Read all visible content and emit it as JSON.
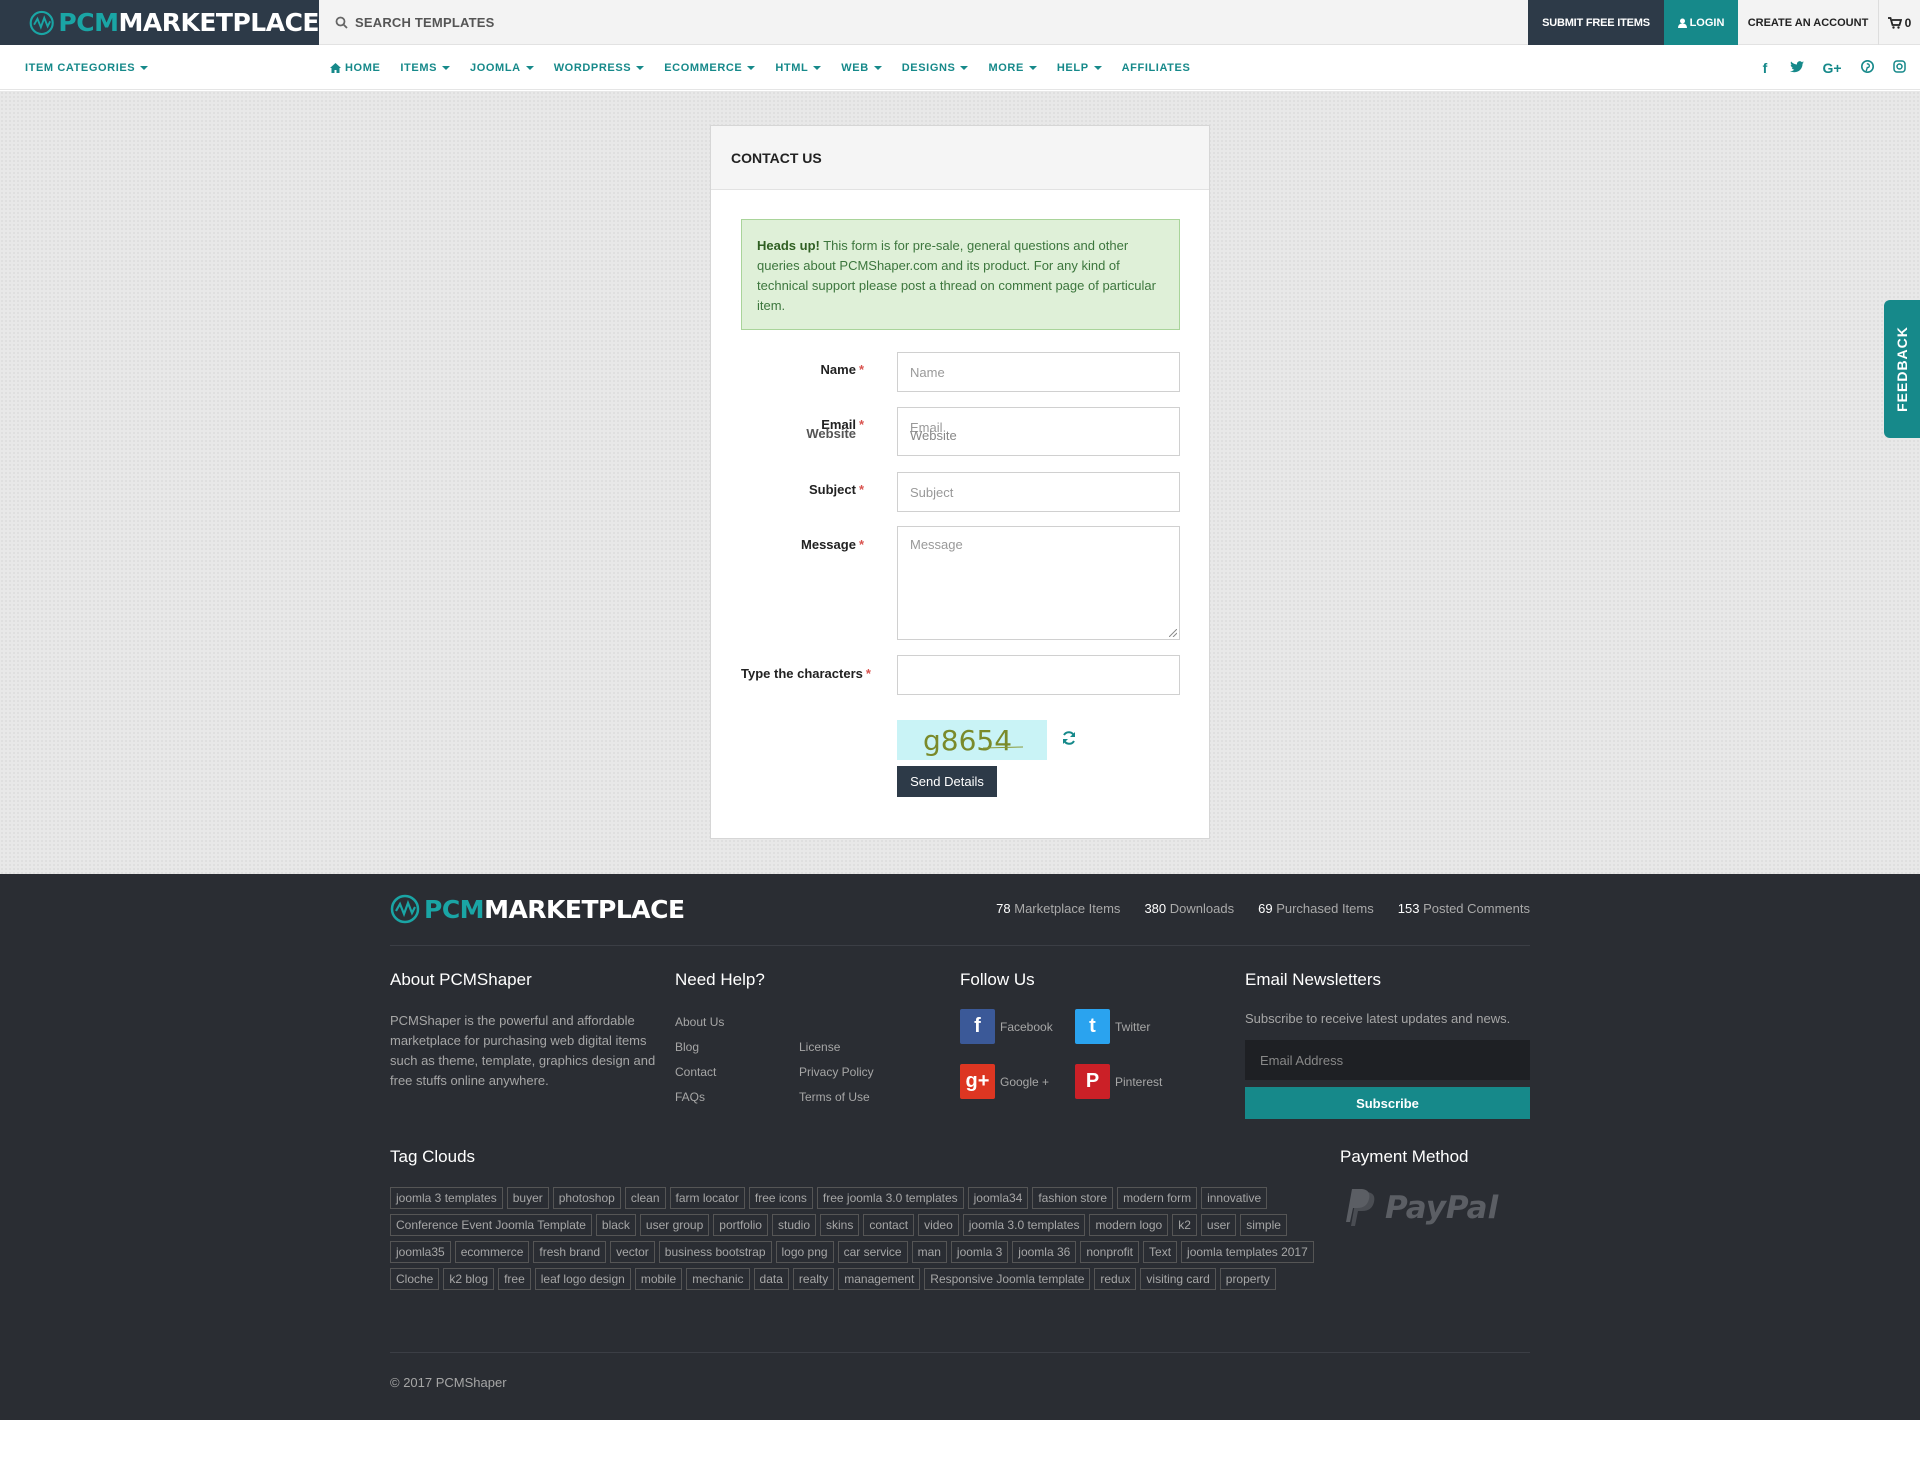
{
  "header": {
    "logo": {
      "pcm": "PCM",
      "rest": "MARKETPLACE"
    },
    "search_placeholder": "SEARCH TEMPLATES",
    "submit_label": "SUBMIT FREE ITEMS",
    "login_label": "LOGIN",
    "create_label": "CREATE AN ACCOUNT",
    "cart_count": "0"
  },
  "nav": {
    "categories_label": "ITEM CATEGORIES",
    "items": [
      {
        "label": "HOME",
        "dropdown": false
      },
      {
        "label": "ITEMS",
        "dropdown": true
      },
      {
        "label": "JOOMLA",
        "dropdown": true
      },
      {
        "label": "WORDPRESS",
        "dropdown": true
      },
      {
        "label": "ECOMMERCE",
        "dropdown": true
      },
      {
        "label": "HTML",
        "dropdown": true
      },
      {
        "label": "WEB",
        "dropdown": true
      },
      {
        "label": "DESIGNS",
        "dropdown": true
      },
      {
        "label": "MORE",
        "dropdown": true
      },
      {
        "label": "HELP",
        "dropdown": true
      },
      {
        "label": "AFFILIATES",
        "dropdown": false
      }
    ],
    "socials": [
      "facebook-icon",
      "twitter-icon",
      "google-plus-icon",
      "pinterest-icon",
      "instagram-icon"
    ]
  },
  "contact": {
    "title": "CONTACT US",
    "alert_strong": "Heads up!",
    "alert_text": "This form is for pre-sale, general questions and other queries about PCMShaper.com and its product. For any kind of technical support please post a thread on comment page of particular item.",
    "name_label": "Name",
    "name_placeholder": "Name",
    "email_label": "Email",
    "email_placeholder": "Email",
    "website_label": "Website",
    "website_placeholder": "Website",
    "subject_label": "Subject",
    "subject_placeholder": "Subject",
    "message_label": "Message",
    "message_placeholder": "Message",
    "captcha_label": "Type the characters",
    "captcha_text": "g8654",
    "send_label": "Send Details"
  },
  "feedback_label": "FEEDBACK",
  "footer": {
    "stats": [
      {
        "value": "78",
        "label": "Marketplace Items"
      },
      {
        "value": "380",
        "label": "Downloads"
      },
      {
        "value": "69",
        "label": "Purchased Items"
      },
      {
        "value": "153",
        "label": "Posted Comments"
      }
    ],
    "about_title": "About PCMShaper",
    "about_text": "PCMShaper is the powerful and affordable marketplace for purchasing web digital items such as theme, template, graphics design and free stuffs online anywhere.",
    "help_title": "Need Help?",
    "help_col1": [
      "About Us",
      "Blog",
      "Contact",
      "FAQs"
    ],
    "help_col2": [
      "License",
      "Privacy Policy",
      "Terms of Use"
    ],
    "follow_title": "Follow Us",
    "follow": [
      {
        "label": "Facebook",
        "icon": "facebook-icon",
        "color": "#3b5998"
      },
      {
        "label": "Twitter",
        "icon": "twitter-icon",
        "color": "#2aa3ef"
      },
      {
        "label": "Google +",
        "icon": "google-plus-icon",
        "color": "#dd3622"
      },
      {
        "label": "Pinterest",
        "icon": "pinterest-icon",
        "color": "#cb2027"
      }
    ],
    "newsletter_title": "Email Newsletters",
    "newsletter_text": "Subscribe to receive latest updates and news.",
    "newsletter_placeholder": "Email Address",
    "subscribe_label": "Subscribe",
    "tags_title": "Tag Clouds",
    "tags": [
      "joomla 3 templates",
      "buyer",
      "photoshop",
      "clean",
      "farm locator",
      "free icons",
      "free joomla 3.0 templates",
      "joomla34",
      "fashion store",
      "modern form",
      "innovative",
      "Conference Event Joomla Template",
      "black",
      "user group",
      "portfolio",
      "studio",
      "skins",
      "contact",
      "video",
      "joomla 3.0 templates",
      "modern logo",
      "k2",
      "user",
      "simple",
      "joomla35",
      "ecommerce",
      "fresh brand",
      "vector",
      "business bootstrap",
      "logo png",
      "car service",
      "man",
      "joomla 3",
      "joomla 36",
      "nonprofit",
      "Text",
      "joomla templates 2017",
      "Cloche",
      "k2 blog",
      "free",
      "leaf logo design",
      "mobile",
      "mechanic",
      "data",
      "realty",
      "management",
      "Responsive Joomla template",
      "redux",
      "visiting card",
      "property"
    ],
    "payment_title": "Payment Method",
    "paypal_text": "PayPal",
    "copyright": "© 2017 PCMShaper"
  },
  "colors": {
    "accent": "#16898a",
    "dark": "#2d3a48",
    "footer_bg": "#2a2d33"
  }
}
